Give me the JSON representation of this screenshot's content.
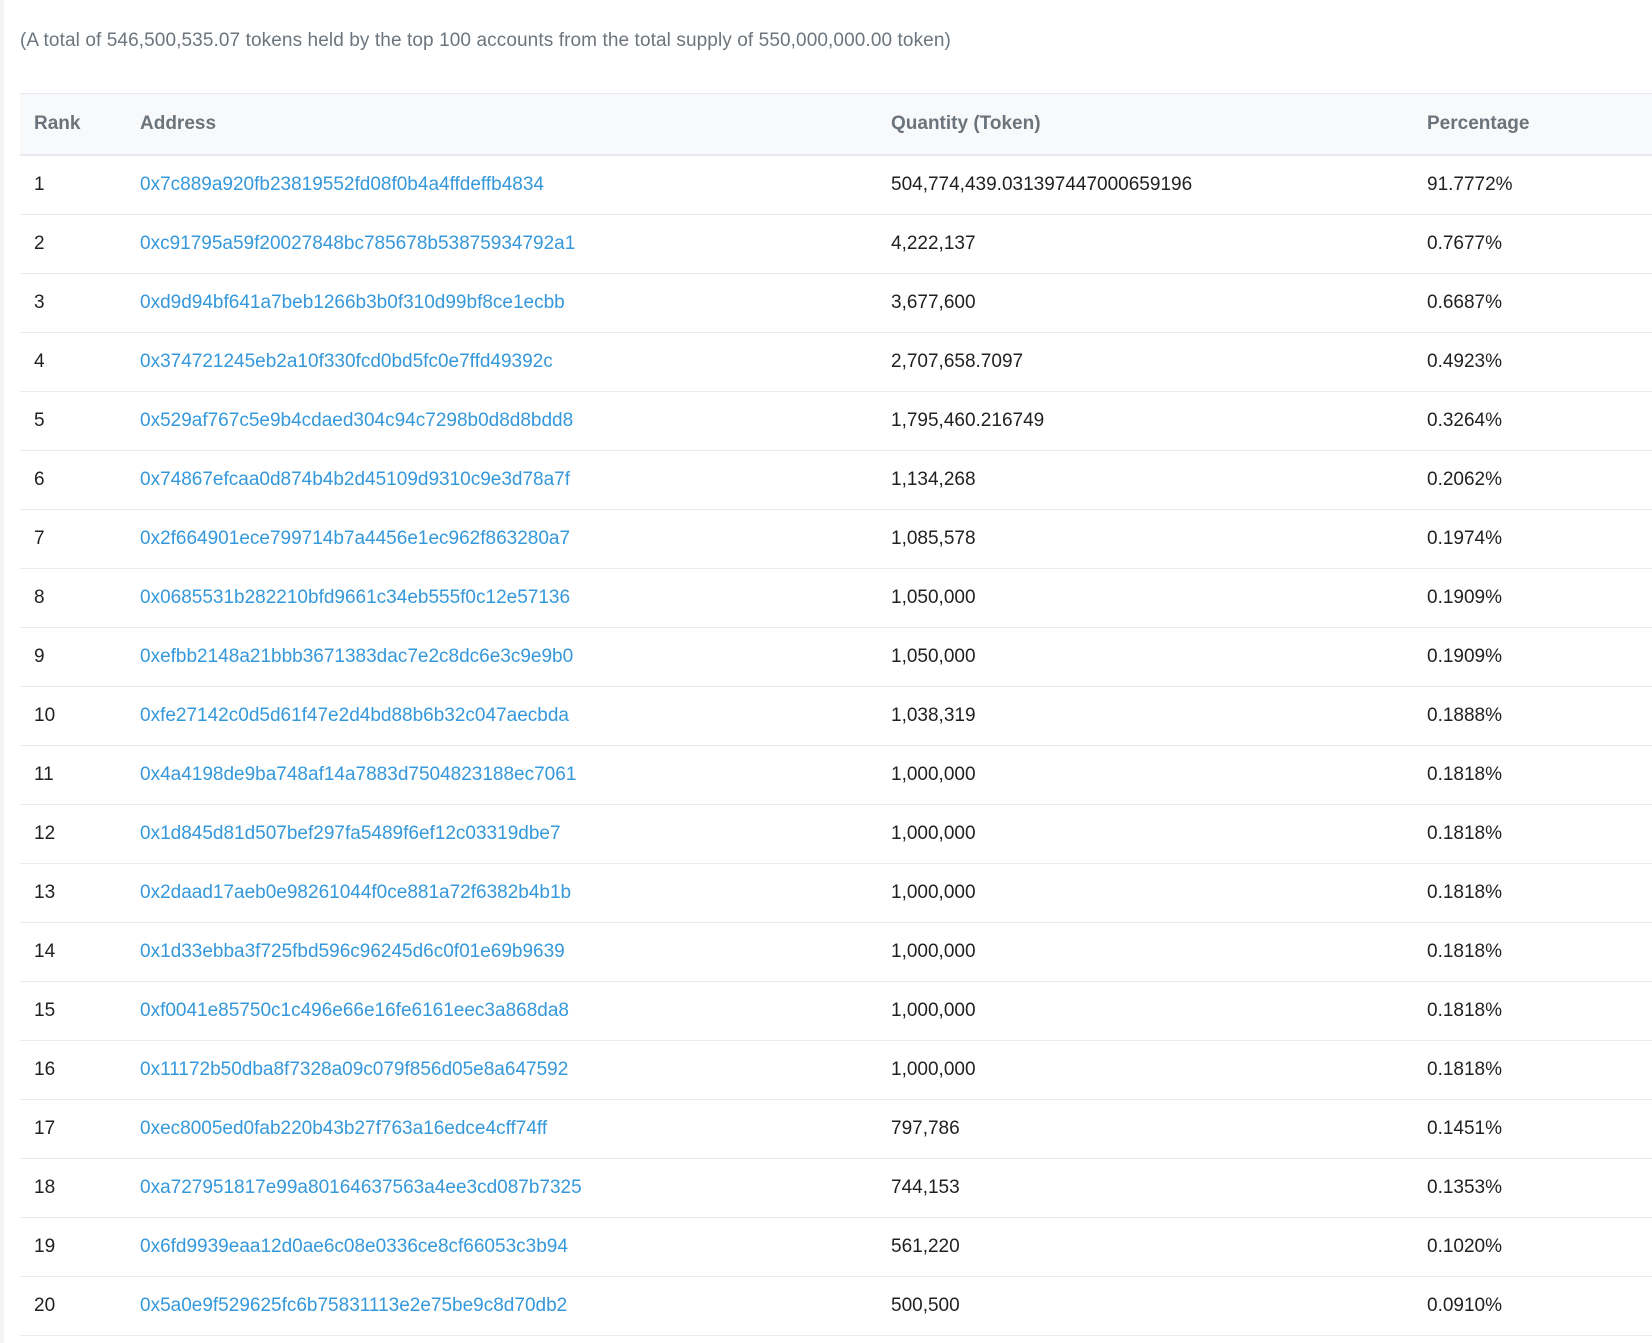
{
  "summary": "(A total of 546,500,535.07 tokens held by the top 100 accounts from the total supply of 550,000,000.00 token)",
  "table": {
    "headers": {
      "rank": "Rank",
      "address": "Address",
      "quantity": "Quantity (Token)",
      "percentage": "Percentage"
    },
    "rows": [
      {
        "rank": "1",
        "address": "0x7c889a920fb23819552fd08f0b4a4ffdeffb4834",
        "quantity": "504,774,439.031397447000659196",
        "percentage": "91.7772%"
      },
      {
        "rank": "2",
        "address": "0xc91795a59f20027848bc785678b53875934792a1",
        "quantity": "4,222,137",
        "percentage": "0.7677%"
      },
      {
        "rank": "3",
        "address": "0xd9d94bf641a7beb1266b3b0f310d99bf8ce1ecbb",
        "quantity": "3,677,600",
        "percentage": "0.6687%"
      },
      {
        "rank": "4",
        "address": "0x374721245eb2a10f330fcd0bd5fc0e7ffd49392c",
        "quantity": "2,707,658.7097",
        "percentage": "0.4923%"
      },
      {
        "rank": "5",
        "address": "0x529af767c5e9b4cdaed304c94c7298b0d8d8bdd8",
        "quantity": "1,795,460.216749",
        "percentage": "0.3264%"
      },
      {
        "rank": "6",
        "address": "0x74867efcaa0d874b4b2d45109d9310c9e3d78a7f",
        "quantity": "1,134,268",
        "percentage": "0.2062%"
      },
      {
        "rank": "7",
        "address": "0x2f664901ece799714b7a4456e1ec962f863280a7",
        "quantity": "1,085,578",
        "percentage": "0.1974%"
      },
      {
        "rank": "8",
        "address": "0x0685531b282210bfd9661c34eb555f0c12e57136",
        "quantity": "1,050,000",
        "percentage": "0.1909%"
      },
      {
        "rank": "9",
        "address": "0xefbb2148a21bbb3671383dac7e2c8dc6e3c9e9b0",
        "quantity": "1,050,000",
        "percentage": "0.1909%"
      },
      {
        "rank": "10",
        "address": "0xfe27142c0d5d61f47e2d4bd88b6b32c047aecbda",
        "quantity": "1,038,319",
        "percentage": "0.1888%"
      },
      {
        "rank": "11",
        "address": "0x4a4198de9ba748af14a7883d7504823188ec7061",
        "quantity": "1,000,000",
        "percentage": "0.1818%"
      },
      {
        "rank": "12",
        "address": "0x1d845d81d507bef297fa5489f6ef12c03319dbe7",
        "quantity": "1,000,000",
        "percentage": "0.1818%"
      },
      {
        "rank": "13",
        "address": "0x2daad17aeb0e98261044f0ce881a72f6382b4b1b",
        "quantity": "1,000,000",
        "percentage": "0.1818%"
      },
      {
        "rank": "14",
        "address": "0x1d33ebba3f725fbd596c96245d6c0f01e69b9639",
        "quantity": "1,000,000",
        "percentage": "0.1818%"
      },
      {
        "rank": "15",
        "address": "0xf0041e85750c1c496e66e16fe6161eec3a868da8",
        "quantity": "1,000,000",
        "percentage": "0.1818%"
      },
      {
        "rank": "16",
        "address": "0x11172b50dba8f7328a09c079f856d05e8a647592",
        "quantity": "1,000,000",
        "percentage": "0.1818%"
      },
      {
        "rank": "17",
        "address": "0xec8005ed0fab220b43b27f763a16edce4cff74ff",
        "quantity": "797,786",
        "percentage": "0.1451%"
      },
      {
        "rank": "18",
        "address": "0xa727951817e99a80164637563a4ee3cd087b7325",
        "quantity": "744,153",
        "percentage": "0.1353%"
      },
      {
        "rank": "19",
        "address": "0x6fd9939eaa12d0ae6c08e0336ce8cf66053c3b94",
        "quantity": "561,220",
        "percentage": "0.1020%"
      },
      {
        "rank": "20",
        "address": "0x5a0e9f529625fc6b75831113e2e75be9c8d70db2",
        "quantity": "500,500",
        "percentage": "0.0910%"
      }
    ]
  }
}
